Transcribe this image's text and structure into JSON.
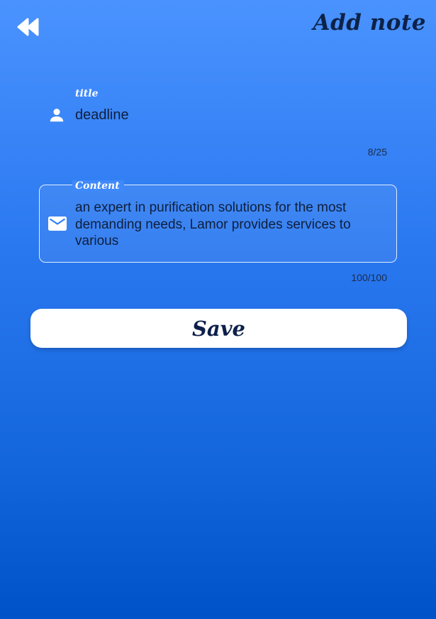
{
  "header": {
    "back_icon": "rewind-back-icon",
    "title": "Add note"
  },
  "title_field": {
    "label": "title",
    "icon": "person-icon",
    "value": "deadline",
    "counter": "8/25"
  },
  "content_field": {
    "label": "Content",
    "icon": "mail-icon",
    "value": "an expert in purification solutions for the most demanding needs, Lamor provides services to various",
    "counter": "100/100"
  },
  "actions": {
    "save_label": "Save"
  },
  "colors": {
    "background_top": "#4a93ff",
    "background_bottom": "#0052c8",
    "text_dark": "#0d2247",
    "button_bg": "#ffffff"
  }
}
